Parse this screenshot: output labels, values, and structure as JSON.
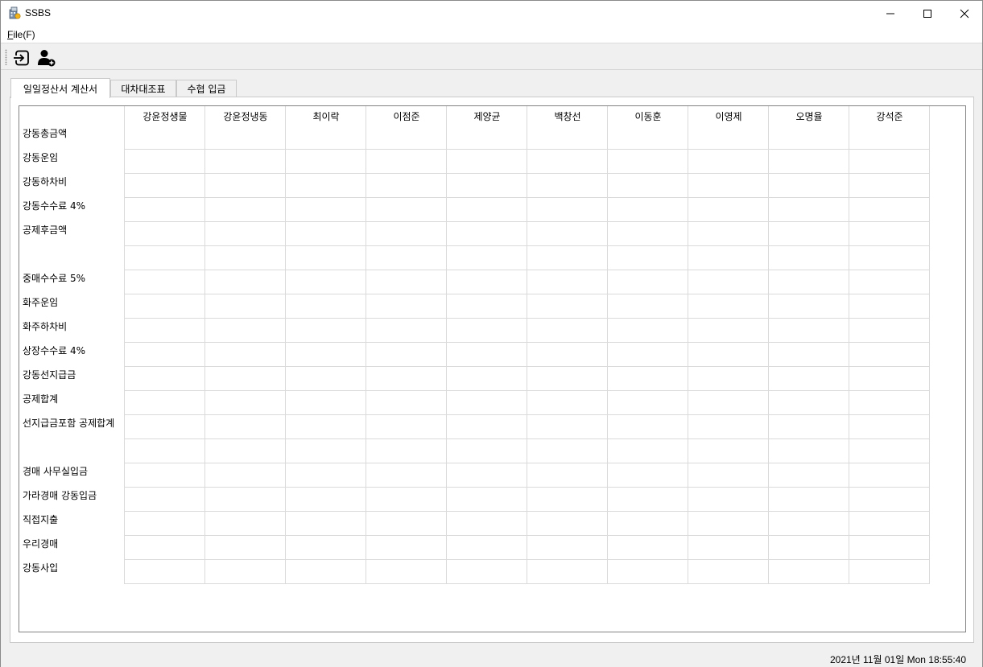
{
  "window": {
    "title": "SSBS"
  },
  "menu": {
    "file_mnemonic": "F",
    "file_rest": "ile(F)"
  },
  "toolbar": {
    "buttons": [
      {
        "icon": "login-icon"
      },
      {
        "icon": "add-user-icon"
      }
    ]
  },
  "tabs": [
    {
      "label": "일일정산서 계산서",
      "active": true
    },
    {
      "label": "대차대조표",
      "active": false
    },
    {
      "label": "수협 입금",
      "active": false
    }
  ],
  "table": {
    "columns": [
      "강윤정생물",
      "강윤정냉동",
      "최이락",
      "이점준",
      "제양균",
      "백창선",
      "이동훈",
      "이영제",
      "오명율",
      "강석준"
    ],
    "rows": [
      "강동총금액",
      "강동운임",
      "강동하차비",
      "강동수수료 4%",
      "공제후금액",
      "",
      "중매수수료 5%",
      "화주운임",
      "화주하차비",
      "상장수수료 4%",
      "강동선지급금",
      "공제합계",
      "선지급금포함 공제합계",
      "",
      "경매 사무실입금",
      "가라경매 강동입금",
      "직접지출",
      "우리경매",
      "강동사입"
    ]
  },
  "status": {
    "datetime": "2021년 11월 01일 Mon 18:55:40"
  }
}
